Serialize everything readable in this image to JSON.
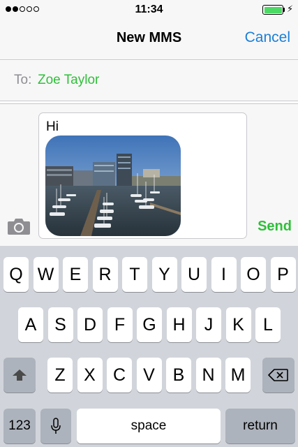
{
  "status_bar": {
    "time": "11:34",
    "signal_dots_total": 5,
    "signal_dots_filled": 2,
    "battery_level": 1.0,
    "battery_color": "#4cd964"
  },
  "nav": {
    "title": "New MMS",
    "cancel_label": "Cancel"
  },
  "recipient": {
    "label": "To:",
    "name": "Zoe Taylor"
  },
  "message": {
    "text": "Hi",
    "attachment": "harbour-photo",
    "send_label": "Send"
  },
  "keyboard": {
    "row1": [
      "Q",
      "W",
      "E",
      "R",
      "T",
      "Y",
      "U",
      "I",
      "O",
      "P"
    ],
    "row2": [
      "A",
      "S",
      "D",
      "F",
      "G",
      "H",
      "J",
      "K",
      "L"
    ],
    "row3": [
      "Z",
      "X",
      "C",
      "V",
      "B",
      "N",
      "M"
    ],
    "numbers_label": "123",
    "space_label": "space",
    "return_label": "return"
  },
  "colors": {
    "accent_blue": "#1a7fd6",
    "accent_green": "#2fbf3a"
  }
}
